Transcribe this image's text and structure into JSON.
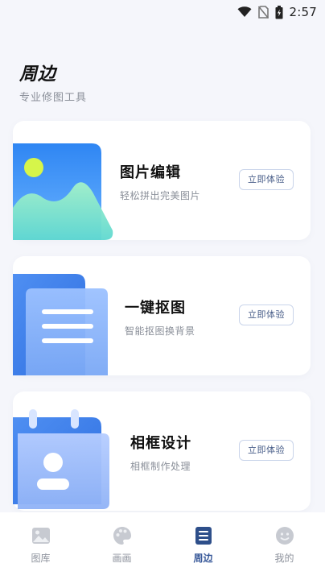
{
  "status_bar": {
    "time": "2:57",
    "icons": [
      "wifi-icon",
      "no-sim-icon",
      "battery-icon"
    ]
  },
  "header": {
    "title": "周边",
    "subtitle": "专业修图工具"
  },
  "cards": [
    {
      "title": "图片编辑",
      "desc": "轻松拼出完美图片",
      "button": "立即体验",
      "icon": "landscape-image-icon"
    },
    {
      "title": "一键抠图",
      "desc": "智能抠图换背景",
      "button": "立即体验",
      "icon": "document-icon"
    },
    {
      "title": "相框设计",
      "desc": "相框制作处理",
      "button": "立即体验",
      "icon": "calendar-portrait-icon"
    }
  ],
  "tab_bar": {
    "active_index": 2,
    "tabs": [
      {
        "label": "图库",
        "icon": "gallery-icon"
      },
      {
        "label": "画画",
        "icon": "palette-icon"
      },
      {
        "label": "周边",
        "icon": "list-icon"
      },
      {
        "label": "我的",
        "icon": "profile-icon"
      }
    ]
  },
  "colors": {
    "background": "#f5f6fb",
    "accent": "#3a5a9a",
    "card_blue": "#4a86f0"
  }
}
